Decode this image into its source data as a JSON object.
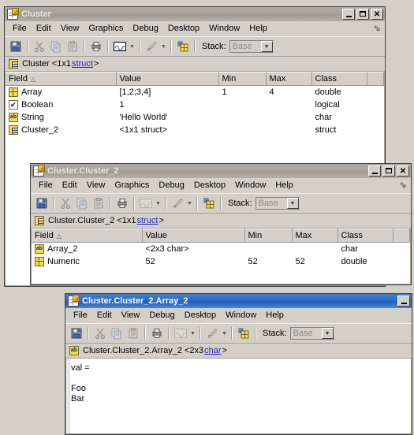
{
  "desktop": {
    "background": "#d4d0c8"
  },
  "windows": [
    {
      "id": "cluster",
      "title": "Cluster",
      "active": false,
      "menus": [
        "File",
        "Edit",
        "View",
        "Graphics",
        "Debug",
        "Desktop",
        "Window",
        "Help"
      ],
      "toolbar": {
        "stack_label": "Stack:",
        "stack_value": "Base",
        "buttons": [
          "save-icon",
          "cut-icon",
          "copy-icon",
          "paste-icon",
          "print-icon",
          "plot-icon",
          "brush-icon",
          "insert-icon"
        ]
      },
      "varstrip": {
        "icon": "struct-icon",
        "name": "Cluster",
        "size": "<1x1 ",
        "class_link": "struct",
        "suffix": ">"
      },
      "table": {
        "columns": [
          "Field",
          "Value",
          "Min",
          "Max",
          "Class",
          ""
        ],
        "sorted_column": "Field",
        "rows": [
          {
            "icon": "array-icon",
            "field": "Array",
            "value": "[1,2;3,4]",
            "min": "1",
            "max": "4",
            "class": "double"
          },
          {
            "icon": "boolean-icon",
            "field": "Boolean",
            "value": "1",
            "min": "",
            "max": "",
            "class": "logical"
          },
          {
            "icon": "char-icon",
            "field": "String",
            "value": "'Hello World'",
            "min": "",
            "max": "",
            "class": "char"
          },
          {
            "icon": "struct-icon",
            "field": "Cluster_2",
            "value": "<1x1 struct>",
            "min": "",
            "max": "",
            "class": "struct"
          }
        ]
      },
      "window_buttons": [
        "minimize",
        "maximize",
        "close"
      ]
    },
    {
      "id": "cluster2",
      "title": "Cluster.Cluster_2",
      "active": false,
      "menus": [
        "File",
        "Edit",
        "View",
        "Graphics",
        "Debug",
        "Desktop",
        "Window",
        "Help"
      ],
      "toolbar": {
        "stack_label": "Stack:",
        "stack_value": "Base",
        "buttons": [
          "save-icon",
          "cut-icon",
          "copy-icon",
          "paste-icon",
          "print-icon",
          "plot-icon",
          "brush-icon",
          "insert-icon"
        ]
      },
      "varstrip": {
        "icon": "struct-icon",
        "name": "Cluster.Cluster_2",
        "size": "<1x1 ",
        "class_link": "struct",
        "suffix": ">"
      },
      "table": {
        "columns": [
          "Field",
          "Value",
          "Min",
          "Max",
          "Class",
          ""
        ],
        "sorted_column": "Field",
        "rows": [
          {
            "icon": "char-icon",
            "field": "Array_2",
            "value": "<2x3 char>",
            "min": "",
            "max": "",
            "class": "char"
          },
          {
            "icon": "array-icon",
            "field": "Numeric",
            "value": "52",
            "min": "52",
            "max": "52",
            "class": "double"
          }
        ]
      },
      "window_buttons": [
        "minimize",
        "maximize",
        "close"
      ]
    },
    {
      "id": "array2",
      "title": "Cluster.Cluster_2.Array_2",
      "active": true,
      "menus": [
        "File",
        "Edit",
        "View",
        "Debug",
        "Desktop",
        "Window",
        "Help"
      ],
      "toolbar": {
        "stack_label": "Stack:",
        "stack_value": "Base",
        "buttons": [
          "save-icon",
          "cut-icon",
          "copy-icon",
          "paste-icon",
          "print-icon",
          "plot-icon",
          "brush-icon",
          "insert-icon"
        ]
      },
      "varstrip": {
        "icon": "char-icon",
        "name": "Cluster.Cluster_2.Array_2",
        "size": "<2x3 ",
        "class_link": "char",
        "suffix": ">"
      },
      "content_text": "val =\n\nFoo\nBar",
      "window_buttons": [
        "minimize"
      ]
    }
  ],
  "colors": {
    "window_face": "#d4d0c8",
    "title_active": "#2d6cc0",
    "title_inactive": "#a7a39b",
    "link": "#2222cc",
    "icon_yellow": "#f7d94c"
  }
}
